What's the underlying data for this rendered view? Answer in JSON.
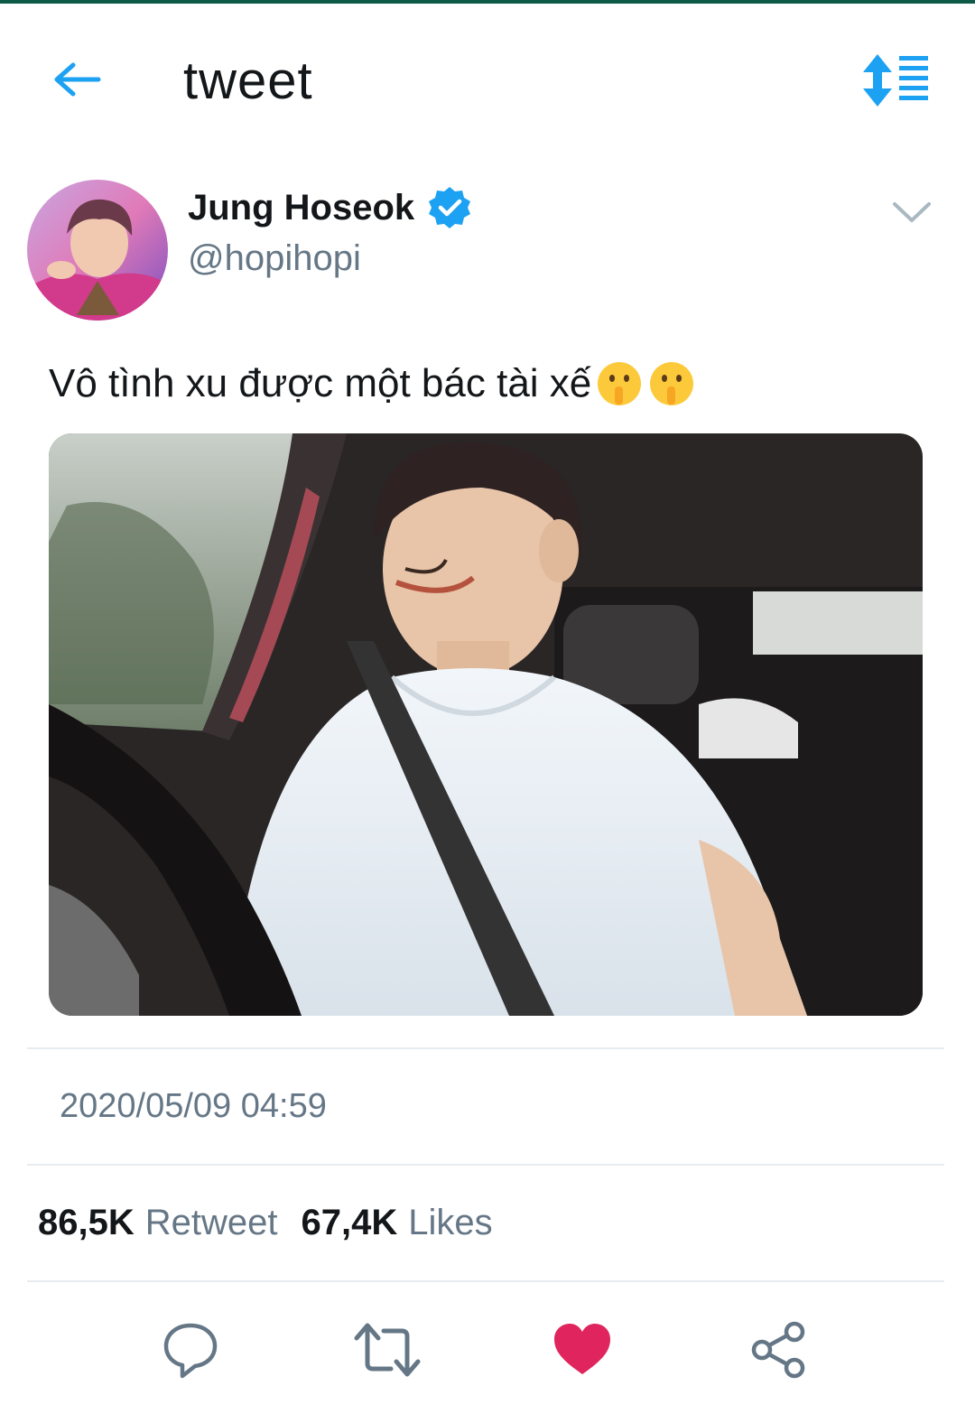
{
  "header": {
    "title": "tweet",
    "back_icon": "arrow-left-icon",
    "sort_icon": "sort-list-icon"
  },
  "author": {
    "display_name": "Jung Hoseok",
    "handle": "@hopihopi",
    "verified": true
  },
  "tweet": {
    "text": "Vô tình xu được một bác tài xế",
    "emoji": [
      "shushing-face-emoji",
      "shushing-face-emoji"
    ]
  },
  "timestamp": "2020/05/09 04:59",
  "stats": {
    "retweets_count": "86,5K",
    "retweets_label": "Retweet",
    "likes_count": "67,4K",
    "likes_label": "Likes"
  },
  "actions": [
    {
      "icon": "reply-icon"
    },
    {
      "icon": "retweet-icon"
    },
    {
      "icon": "heart-icon",
      "active": true
    },
    {
      "icon": "share-icon"
    }
  ],
  "colors": {
    "accent": "#1da1f2",
    "like": "#e0245e",
    "muted": "#657786",
    "text": "#14171a"
  }
}
